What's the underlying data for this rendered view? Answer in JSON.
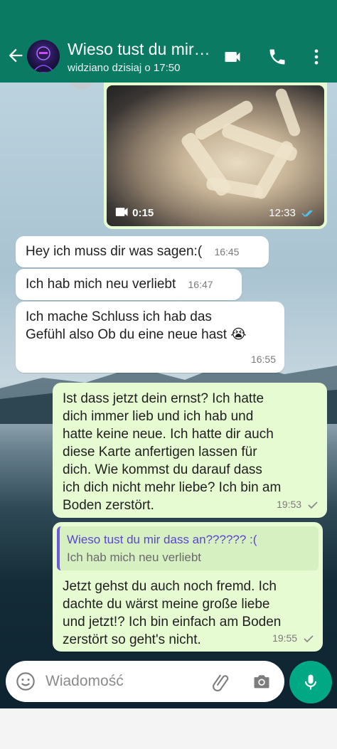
{
  "header": {
    "title": "Wieso tust du mir dass an?????? :(",
    "status": "widziano dzisiaj o 17:50",
    "icons": [
      "back-arrow-icon",
      "video-call-icon",
      "phone-icon",
      "more-vert-icon"
    ]
  },
  "video": {
    "duration": "0:15",
    "time": "12:33"
  },
  "messages": [
    {
      "text": "Hey ich muss dir was sagen:(",
      "time": "16:45"
    },
    {
      "text": "Ich hab mich neu  verliebt",
      "time": "16:47"
    },
    {
      "line1": "Ich mache Schluss ich hab das",
      "line2": "Gefühl also Ob du eine neue hast 😭",
      "time": "16:55"
    },
    {
      "lines": [
        "Ist dass jetzt dein ernst? Ich hatte",
        "dich immer lieb und ich hab und",
        "hatte keine neue. Ich hatte dir auch",
        "diese Karte anfertigen lassen für",
        "dich. Wie kommst du darauf dass",
        "ich dich nicht mehr liebe? Ich bin am",
        "Boden zerstört."
      ],
      "time": "19:53"
    },
    {
      "quote_name": "Wieso tust du mir dass an?????? :(",
      "quote_text": "Ich hab mich neu  verliebt",
      "lines": [
        "Jetzt gehst du auch noch fremd. Ich",
        "dachte du wärst meine große liebe",
        "und jetzt!? Ich bin einfach am Boden",
        "zerstört so geht's nicht."
      ],
      "time": "19:55"
    }
  ],
  "composer": {
    "placeholder": "Wiadomość"
  },
  "colors": {
    "header": "#0b7a62",
    "outgoing": "#e7fbd3",
    "incoming": "#ffffff",
    "mic": "#00a884",
    "read_ticks": "#53bdeb"
  }
}
